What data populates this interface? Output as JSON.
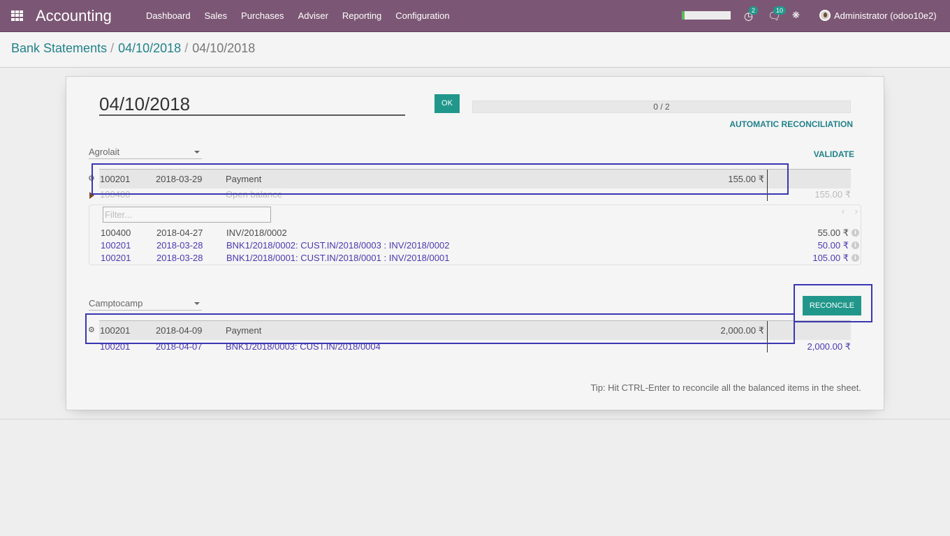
{
  "navbar": {
    "brand": "Accounting",
    "menu": [
      "Dashboard",
      "Sales",
      "Purchases",
      "Adviser",
      "Reporting",
      "Configuration"
    ],
    "activity_badge": "2",
    "messages_badge": "10",
    "user": "Administrator (odoo10e2)",
    "icons": [
      "apps-icon",
      "clock-icon",
      "chat-icon",
      "bug-icon",
      "avatar"
    ]
  },
  "breadcrumb": {
    "items": [
      "Bank Statements",
      "04/10/2018"
    ],
    "current": "04/10/2018",
    "separator": "/"
  },
  "statement": {
    "name": "04/10/2018",
    "ok_label": "OK",
    "progress_text": "0 / 2",
    "progress_value": 0,
    "auto_reconcile_label": "AUTOMATIC RECONCILIATION"
  },
  "line1": {
    "partner": "Agrolait",
    "validate_label": "VALIDATE",
    "row": {
      "account": "100201",
      "date": "2018-03-29",
      "label": "Payment",
      "amount": "155.00 ₹"
    },
    "proposition": {
      "account": "100400",
      "label": "Open balance",
      "amount": "155.00 ₹"
    },
    "filter_placeholder": "Filter...",
    "pager": {
      "prev": "‹",
      "next": "›"
    },
    "matches": [
      {
        "account": "100400",
        "date": "2018-04-27",
        "label": "INV/2018/0002",
        "amount": "55.00 ₹"
      },
      {
        "account": "100201",
        "date": "2018-03-28",
        "label": "BNK1/2018/0002: CUST.IN/2018/0003 : INV/2018/0002",
        "amount": "50.00 ₹"
      },
      {
        "account": "100201",
        "date": "2018-03-28",
        "label": "BNK1/2018/0001: CUST.IN/2018/0001 : INV/2018/0001",
        "amount": "105.00 ₹"
      }
    ]
  },
  "line2": {
    "partner": "Camptocamp",
    "reconcile_label": "RECONCILE",
    "row": {
      "account": "100201",
      "date": "2018-04-09",
      "label": "Payment",
      "amount": "2,000.00 ₹"
    },
    "proposition": {
      "account": "100201",
      "date": "2018-04-07",
      "label": "BNK1/2018/0003: CUST.IN/2018/0004",
      "amount": "2,000.00 ₹"
    }
  },
  "tip": "Tip: Hit CTRL-Enter to reconcile all the balanced items in the sheet.",
  "colors": {
    "navbar": "#7c5775",
    "accent": "#21978b",
    "link": "#21828a",
    "match_link": "#4b3ab0",
    "annotation": "#3a36b2"
  }
}
